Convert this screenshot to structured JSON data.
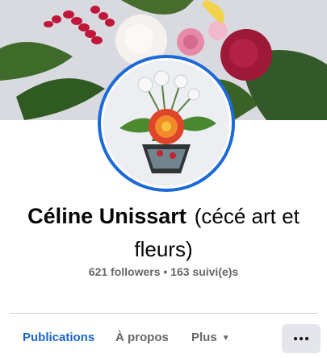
{
  "profile": {
    "name": "Céline Unissart",
    "nickname": "(cécé art et fleurs)",
    "stats": "621 followers • 163 suivi(e)s"
  },
  "tabs": {
    "publications": "Publications",
    "about": "À propos",
    "more": "Plus"
  },
  "icons": {
    "more_caret": "caret-down-icon",
    "options": "ellipsis-icon"
  },
  "colors": {
    "accent": "#1b64c8",
    "avatar_ring": "#1b6ad8",
    "muted_text": "#65676b",
    "button_bg": "#e4e6eb"
  }
}
